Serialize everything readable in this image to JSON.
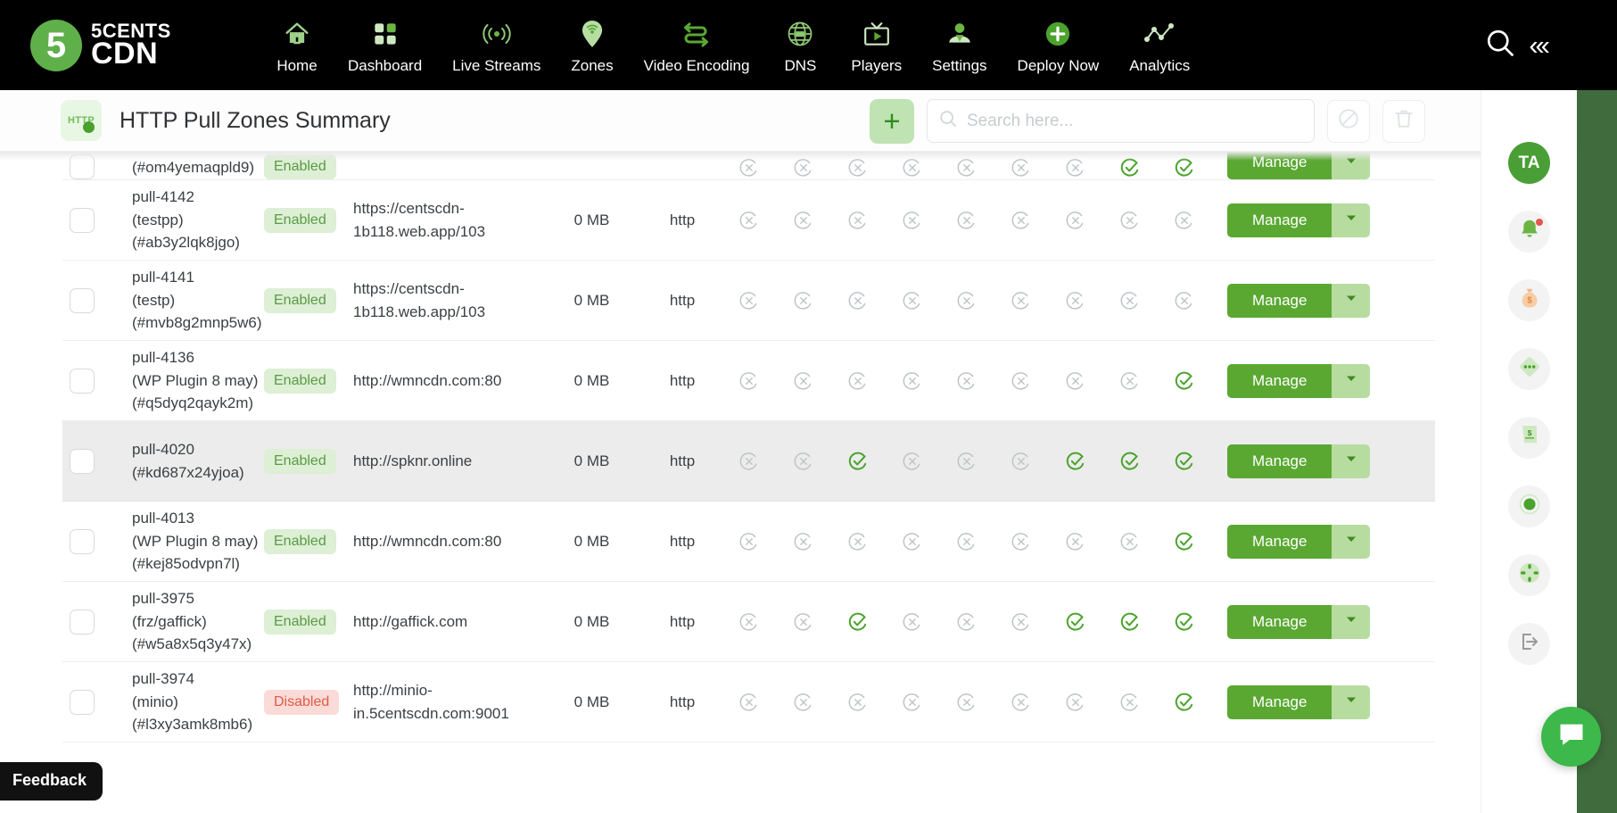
{
  "brand": {
    "mark": "5",
    "line1": "5CENTS",
    "line2": "CDN"
  },
  "nav": {
    "items": [
      {
        "label": "Home",
        "icon": "home-icon"
      },
      {
        "label": "Dashboard",
        "icon": "dashboard-grid-icon"
      },
      {
        "label": "Live Streams",
        "icon": "broadcast-icon"
      },
      {
        "label": "Zones",
        "icon": "map-pin-wifi-icon"
      },
      {
        "label": "Video Encoding",
        "icon": "transcode-arrows-icon"
      },
      {
        "label": "DNS",
        "icon": "globe-dns-icon"
      },
      {
        "label": "Players",
        "icon": "tv-play-icon"
      },
      {
        "label": "Settings",
        "icon": "user-gear-icon"
      },
      {
        "label": "Deploy Now",
        "icon": "plus-circle-icon"
      },
      {
        "label": "Analytics",
        "icon": "line-chart-icon"
      }
    ],
    "search_icon": "search-icon",
    "collapse_icon": "chevrons-left-icon",
    "collapse_label": "«‹"
  },
  "header": {
    "badge_text": "HTTP",
    "badge_dot": "⚡",
    "title": "HTTP Pull Zones Summary",
    "add_label": "+",
    "search_placeholder": "Search here...",
    "search_value": "",
    "ban_icon": "ban-icon",
    "delete_icon": "trash-icon"
  },
  "accent": {
    "green": "#5aa832",
    "light_green": "#b6dca0",
    "red": "#e05a46",
    "black": "#000000"
  },
  "table": {
    "manage_label": "Manage",
    "flag_count": 9,
    "rows": [
      {
        "name": "",
        "alias": "",
        "id": "(#om4yemaqpld9)",
        "status": "Enabled",
        "origin": "",
        "size": "",
        "proto": "",
        "flags": [
          0,
          0,
          0,
          0,
          0,
          0,
          0,
          1,
          1
        ],
        "clipped": true,
        "highlight": false
      },
      {
        "name": "pull-4142",
        "alias": "(testpp)",
        "id": "(#ab3y2lqk8jgo)",
        "status": "Enabled",
        "origin": "https://centscdn-1b118.web.app/103",
        "size": "0 MB",
        "proto": "http",
        "flags": [
          0,
          0,
          0,
          0,
          0,
          0,
          0,
          0,
          0
        ],
        "clipped": false,
        "highlight": false
      },
      {
        "name": "pull-4141",
        "alias": "(testp)",
        "id": "(#mvb8g2mnp5w6)",
        "status": "Enabled",
        "origin": "https://centscdn-1b118.web.app/103",
        "size": "0 MB",
        "proto": "http",
        "flags": [
          0,
          0,
          0,
          0,
          0,
          0,
          0,
          0,
          0
        ],
        "clipped": false,
        "highlight": false
      },
      {
        "name": "pull-4136",
        "alias": "(WP Plugin 8 may)",
        "id": "(#q5dyq2qayk2m)",
        "status": "Enabled",
        "origin": "http://wmncdn.com:80",
        "size": "0 MB",
        "proto": "http",
        "flags": [
          0,
          0,
          0,
          0,
          0,
          0,
          0,
          0,
          1
        ],
        "clipped": false,
        "highlight": false
      },
      {
        "name": "pull-4020",
        "alias": "",
        "id": "(#kd687x24yjoa)",
        "status": "Enabled",
        "origin": "http://spknr.online",
        "size": "0 MB",
        "proto": "http",
        "flags": [
          0,
          0,
          1,
          0,
          0,
          0,
          1,
          1,
          1
        ],
        "clipped": false,
        "highlight": true
      },
      {
        "name": "pull-4013",
        "alias": "(WP Plugin 8 may)",
        "id": "(#kej85odvpn7l)",
        "status": "Enabled",
        "origin": "http://wmncdn.com:80",
        "size": "0 MB",
        "proto": "http",
        "flags": [
          0,
          0,
          0,
          0,
          0,
          0,
          0,
          0,
          1
        ],
        "clipped": false,
        "highlight": false
      },
      {
        "name": "pull-3975",
        "alias": "(frz/gaffick)",
        "id": "(#w5a8x5q3y47x)",
        "status": "Enabled",
        "origin": "http://gaffick.com",
        "size": "0 MB",
        "proto": "http",
        "flags": [
          0,
          0,
          1,
          0,
          0,
          0,
          1,
          1,
          1
        ],
        "clipped": false,
        "highlight": false
      },
      {
        "name": "pull-3974",
        "alias": "(minio)",
        "id": "(#l3xy3amk8mb6)",
        "status": "Disabled",
        "origin": "http://minio-in.5centscdn.com:9001",
        "size": "0 MB",
        "proto": "http",
        "flags": [
          0,
          0,
          0,
          0,
          0,
          0,
          0,
          0,
          1
        ],
        "clipped": false,
        "highlight": false
      }
    ]
  },
  "rail": {
    "avatar": "TA",
    "items": [
      {
        "icon": "bell-icon",
        "badge": true
      },
      {
        "icon": "money-bag-icon",
        "badge": false
      },
      {
        "icon": "diamond-dots-icon",
        "badge": false
      },
      {
        "icon": "dollar-bill-icon",
        "badge": false
      },
      {
        "icon": "record-dot-icon",
        "badge": false
      },
      {
        "icon": "crosshair-icon",
        "badge": false
      },
      {
        "icon": "logout-icon",
        "badge": false
      }
    ],
    "chat_icon": "chat-bubble-icon"
  },
  "feedback": {
    "label": "Feedback"
  }
}
